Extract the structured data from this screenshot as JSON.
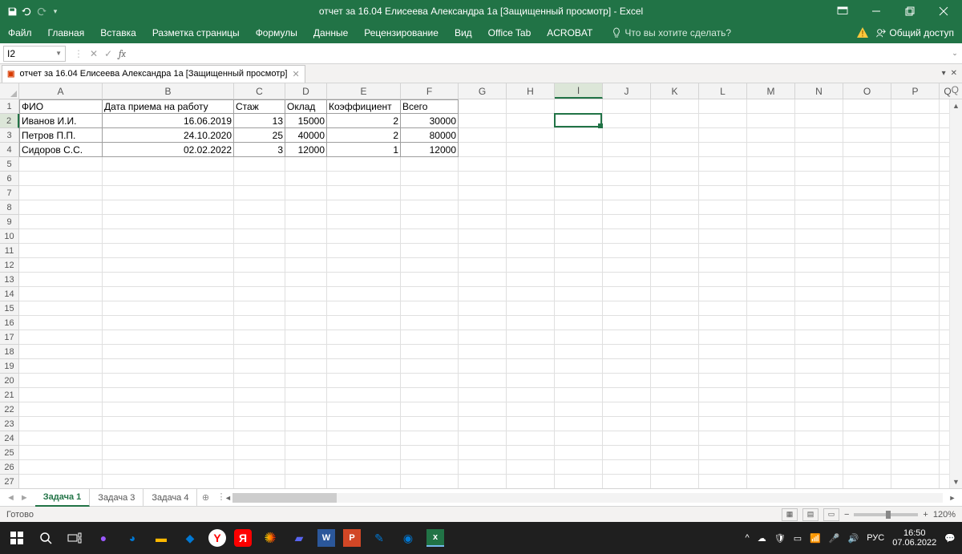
{
  "titlebar": {
    "title": "отчет за 16.04 Елисеева Александра 1а [Защищенный просмотр] - Excel"
  },
  "ribbon": {
    "tabs": [
      "Файл",
      "Главная",
      "Вставка",
      "Разметка страницы",
      "Формулы",
      "Данные",
      "Рецензирование",
      "Вид",
      "Office Tab",
      "ACROBAT"
    ],
    "tell_me": "Что вы хотите сделать?",
    "share": "Общий доступ"
  },
  "formulabar": {
    "name_box": "I2",
    "formula": ""
  },
  "doctab": {
    "icon": "x",
    "label": "отчет за 16.04 Елисеева Александра 1а [Защищенный просмотр]"
  },
  "grid": {
    "columns": [
      {
        "letter": "A",
        "width": 104
      },
      {
        "letter": "B",
        "width": 164
      },
      {
        "letter": "C",
        "width": 64
      },
      {
        "letter": "D",
        "width": 52
      },
      {
        "letter": "E",
        "width": 92
      },
      {
        "letter": "F",
        "width": 72
      },
      {
        "letter": "G",
        "width": 60
      },
      {
        "letter": "H",
        "width": 60
      },
      {
        "letter": "I",
        "width": 60
      },
      {
        "letter": "J",
        "width": 60
      },
      {
        "letter": "K",
        "width": 60
      },
      {
        "letter": "L",
        "width": 60
      },
      {
        "letter": "M",
        "width": 60
      },
      {
        "letter": "N",
        "width": 60
      },
      {
        "letter": "O",
        "width": 60
      },
      {
        "letter": "P",
        "width": 60
      },
      {
        "letter": "Q",
        "width": 20
      }
    ],
    "row_count": 27,
    "active": {
      "row": 2,
      "col": "I"
    },
    "data": [
      {
        "r": 1,
        "c": "A",
        "v": "ФИО",
        "align": "left"
      },
      {
        "r": 1,
        "c": "B",
        "v": "Дата приема на работу",
        "align": "left"
      },
      {
        "r": 1,
        "c": "C",
        "v": "Стаж",
        "align": "left"
      },
      {
        "r": 1,
        "c": "D",
        "v": "Оклад",
        "align": "left"
      },
      {
        "r": 1,
        "c": "E",
        "v": "Коэффициент",
        "align": "left"
      },
      {
        "r": 1,
        "c": "F",
        "v": "Всего",
        "align": "left"
      },
      {
        "r": 2,
        "c": "A",
        "v": "Иванов И.И.",
        "align": "left"
      },
      {
        "r": 2,
        "c": "B",
        "v": "16.06.2019",
        "align": "right"
      },
      {
        "r": 2,
        "c": "C",
        "v": "13",
        "align": "right"
      },
      {
        "r": 2,
        "c": "D",
        "v": "15000",
        "align": "right"
      },
      {
        "r": 2,
        "c": "E",
        "v": "2",
        "align": "right"
      },
      {
        "r": 2,
        "c": "F",
        "v": "30000",
        "align": "right"
      },
      {
        "r": 3,
        "c": "A",
        "v": "Петров П.П.",
        "align": "left"
      },
      {
        "r": 3,
        "c": "B",
        "v": "24.10.2020",
        "align": "right"
      },
      {
        "r": 3,
        "c": "C",
        "v": "25",
        "align": "right"
      },
      {
        "r": 3,
        "c": "D",
        "v": "40000",
        "align": "right"
      },
      {
        "r": 3,
        "c": "E",
        "v": "2",
        "align": "right"
      },
      {
        "r": 3,
        "c": "F",
        "v": "80000",
        "align": "right"
      },
      {
        "r": 4,
        "c": "A",
        "v": "Сидоров С.С.",
        "align": "left"
      },
      {
        "r": 4,
        "c": "B",
        "v": "02.02.2022",
        "align": "right"
      },
      {
        "r": 4,
        "c": "C",
        "v": "3",
        "align": "right"
      },
      {
        "r": 4,
        "c": "D",
        "v": "12000",
        "align": "right"
      },
      {
        "r": 4,
        "c": "E",
        "v": "1",
        "align": "right"
      },
      {
        "r": 4,
        "c": "F",
        "v": "12000",
        "align": "right"
      }
    ]
  },
  "sheets": {
    "tabs": [
      "Задача 1",
      "Задача 3",
      "Задача 4"
    ],
    "active": 0
  },
  "statusbar": {
    "ready": "Готово",
    "zoom": "120%"
  },
  "taskbar": {
    "lang": "РУС",
    "time": "16:50",
    "date": "07.06.2022"
  }
}
